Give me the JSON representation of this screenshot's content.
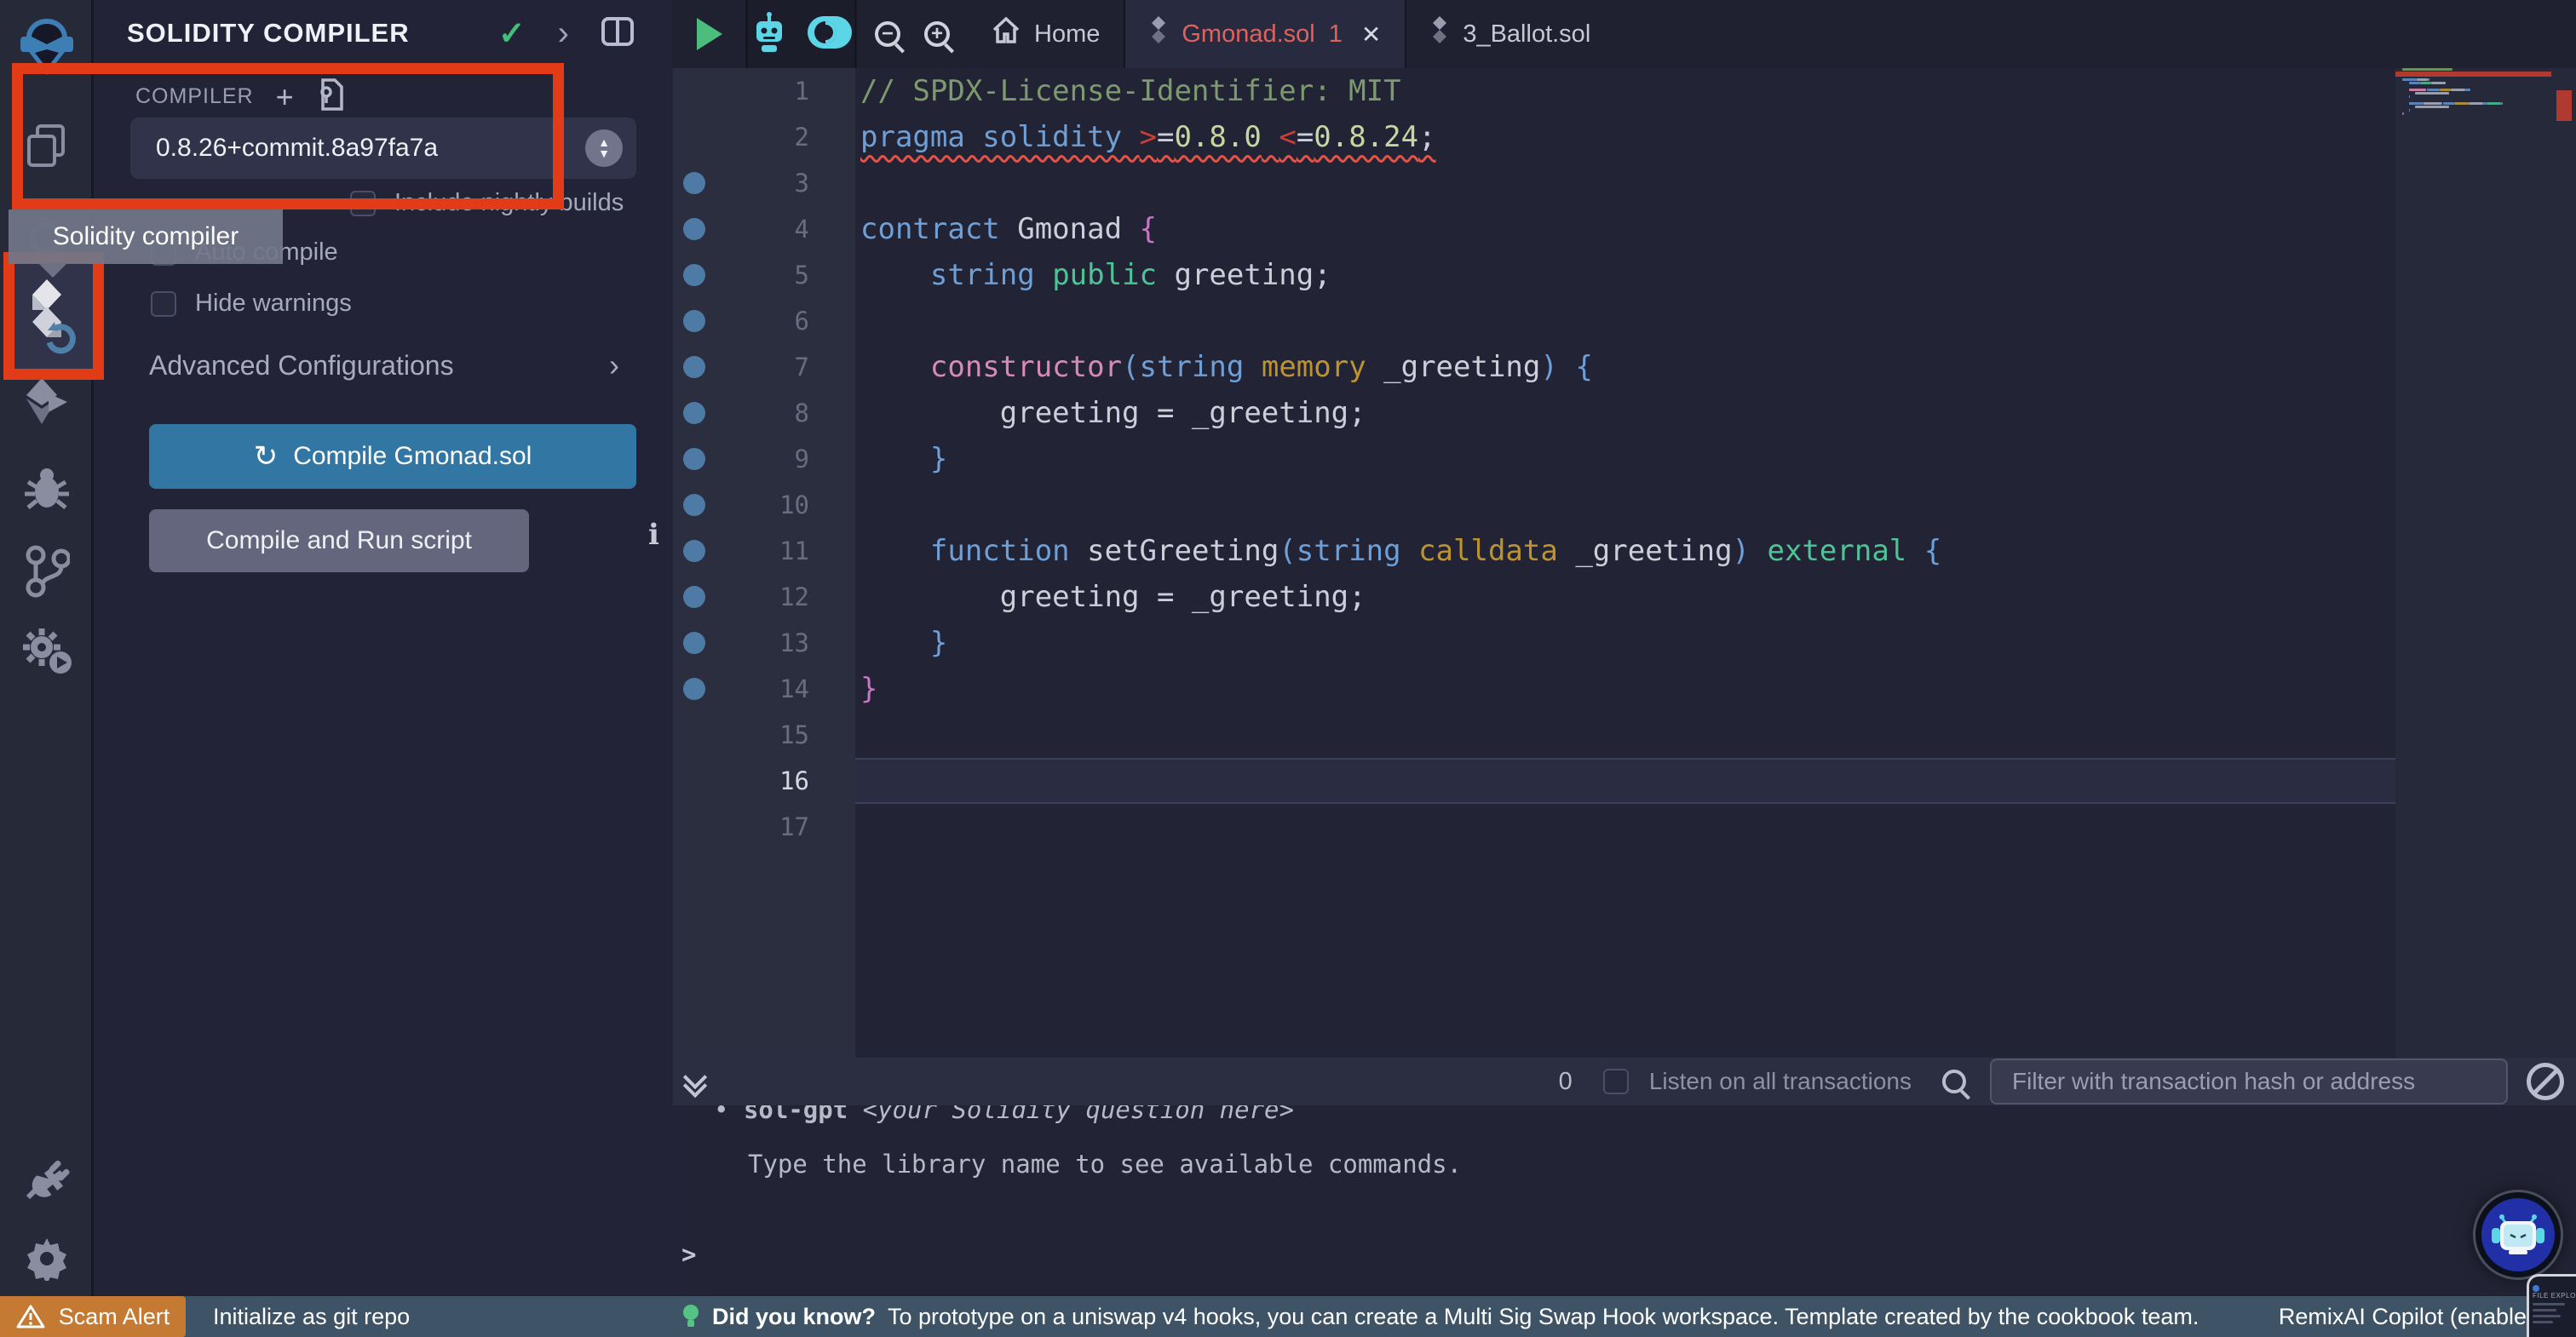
{
  "colors": {
    "background": "#222336",
    "activity_bar": "#262938",
    "accent_blue_button": "#3277a3",
    "annotation_red": "#e23b17",
    "tab_error_red": "#df625c",
    "toolbar_cyan": "#5cd5e6",
    "play_green": "#4cbd7c",
    "check_green": "#42bf7b",
    "status_bar": "#3e5365",
    "scam_alert_orange": "#c57a33",
    "gutter_dot_blue": "#4e7ba6",
    "error_marker": "#b03a30",
    "token_comment": "#7c9a6d",
    "token_keyword": "#6e9fd6",
    "token_plain": "#ccced9",
    "token_constructor": "#d98ab4",
    "token_location": "#bd9332",
    "token_visibility": "#4dc495",
    "token_operator": "#cd3f33",
    "token_number": "#c6d6a0",
    "token_brace_magenta": "#c478c4"
  },
  "activity_bar": {
    "tooltip": "Solidity compiler",
    "items": [
      {
        "name": "remix-logo"
      },
      {
        "name": "file-explorer-icon"
      },
      {
        "name": "search-icon"
      },
      {
        "name": "solidity-compiler-icon",
        "active": true,
        "highlighted": true
      },
      {
        "name": "deploy-run-icon"
      },
      {
        "name": "debugger-icon"
      },
      {
        "name": "git-icon"
      },
      {
        "name": "scripts-runner-icon"
      },
      {
        "name": "plugin-manager-icon"
      },
      {
        "name": "settings-icon"
      }
    ]
  },
  "side_panel": {
    "title": "SOLIDITY COMPILER",
    "compiler_section_label": "COMPILER",
    "version": "0.8.26+commit.8a97fa7a",
    "checkboxes": [
      {
        "label": "Include nightly builds",
        "checked": false,
        "indented": true
      },
      {
        "label": "Auto compile",
        "checked": false,
        "indented": false
      },
      {
        "label": "Hide warnings",
        "checked": false,
        "indented": false
      }
    ],
    "advanced_label": "Advanced Configurations",
    "compile_button": "Compile Gmonad.sol",
    "compile_run_button": "Compile and Run script"
  },
  "editor": {
    "tabs": [
      {
        "label": "Home",
        "icon": "home-icon"
      },
      {
        "label": "Gmonad.sol",
        "icon": "solidity-file-icon",
        "badge": "1",
        "active": true
      },
      {
        "label": "3_Ballot.sol",
        "icon": "solidity-file-icon"
      }
    ],
    "code": {
      "current_line": 16,
      "lines": [
        {
          "n": 1,
          "dot": false,
          "tokens": [
            [
              "cm",
              "// SPDX-License-Identifier: MIT"
            ]
          ]
        },
        {
          "n": 2,
          "dot": false,
          "squiggle": true,
          "tokens": [
            [
              "kw",
              "pragma solidity "
            ],
            [
              "red",
              ">"
            ],
            [
              "pl",
              "="
            ],
            [
              "num",
              "0.8.0"
            ],
            [
              "pl",
              " "
            ],
            [
              "red",
              "<"
            ],
            [
              "pl",
              "="
            ],
            [
              "num",
              "0.8.24"
            ],
            [
              "pl",
              ";"
            ]
          ]
        },
        {
          "n": 3,
          "dot": true,
          "tokens": []
        },
        {
          "n": 4,
          "dot": true,
          "tokens": [
            [
              "kw",
              "contract "
            ],
            [
              "pl",
              "Gmonad "
            ],
            [
              "mag",
              "{"
            ]
          ]
        },
        {
          "n": 5,
          "dot": true,
          "tokens": [
            [
              "pl",
              "    "
            ],
            [
              "kw",
              "string "
            ],
            [
              "grn",
              "public "
            ],
            [
              "pl",
              "greeting;"
            ]
          ]
        },
        {
          "n": 6,
          "dot": true,
          "tokens": []
        },
        {
          "n": 7,
          "dot": true,
          "tokens": [
            [
              "pl",
              "    "
            ],
            [
              "pink",
              "constructor"
            ],
            [
              "blu",
              "("
            ],
            [
              "kw",
              "string "
            ],
            [
              "gold",
              "memory "
            ],
            [
              "pl",
              "_greeting"
            ],
            [
              "blu",
              ") {"
            ]
          ]
        },
        {
          "n": 8,
          "dot": true,
          "tokens": [
            [
              "pl",
              "        greeting = _greeting;"
            ]
          ]
        },
        {
          "n": 9,
          "dot": true,
          "tokens": [
            [
              "blu",
              "    }"
            ]
          ]
        },
        {
          "n": 10,
          "dot": true,
          "tokens": []
        },
        {
          "n": 11,
          "dot": true,
          "tokens": [
            [
              "pl",
              "    "
            ],
            [
              "kw",
              "function "
            ],
            [
              "pl",
              "setGreeting"
            ],
            [
              "blu",
              "("
            ],
            [
              "kw",
              "string "
            ],
            [
              "gold",
              "calldata "
            ],
            [
              "pl",
              "_greeting"
            ],
            [
              "blu",
              ") "
            ],
            [
              "grn",
              "external "
            ],
            [
              "blu",
              "{"
            ]
          ]
        },
        {
          "n": 12,
          "dot": true,
          "tokens": [
            [
              "pl",
              "        greeting = _greeting;"
            ]
          ]
        },
        {
          "n": 13,
          "dot": true,
          "tokens": [
            [
              "blu",
              "    }"
            ]
          ]
        },
        {
          "n": 14,
          "dot": true,
          "tokens": [
            [
              "mag",
              "}"
            ]
          ]
        },
        {
          "n": 15,
          "dot": false,
          "tokens": []
        },
        {
          "n": 16,
          "dot": false,
          "tokens": []
        },
        {
          "n": 17,
          "dot": false,
          "tokens": []
        }
      ]
    }
  },
  "terminal": {
    "count": "0",
    "listen_label": "Listen on all transactions",
    "filter_placeholder": "Filter with transaction hash or address",
    "bullet": "•",
    "gpt_cmd": "sol-gpt",
    "gpt_hint": " <your Solidity question here>",
    "help_line": "Type the library name to see available commands.",
    "prompt": ">"
  },
  "status_bar": {
    "scam_alert": "Scam Alert",
    "git": "Initialize as git repo",
    "tip_title": "Did you know?",
    "tip_text": "To prototype on a uniswap v4 hooks, you can create a Multi Sig Swap Hook workspace. Template created by the cookbook team.",
    "copilot": "RemixAI Copilot (enabled)"
  },
  "pip": {
    "label": "FILE EXPLORER"
  }
}
